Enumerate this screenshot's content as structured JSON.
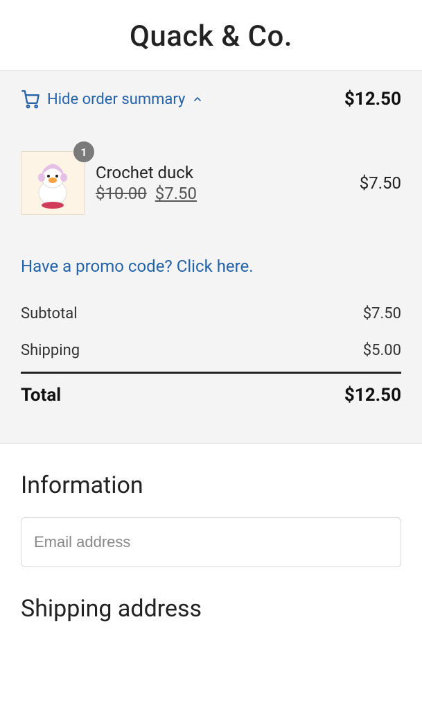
{
  "header": {
    "title": "Quack & Co."
  },
  "summary": {
    "toggle_label": "Hide order summary",
    "total_top": "$12.50",
    "item": {
      "qty": "1",
      "name": "Crochet duck",
      "original_price": "$10.00",
      "sale_price": "$7.50",
      "line_price": "$7.50"
    },
    "promo_link": "Have a promo code? Click here.",
    "subtotal_label": "Subtotal",
    "subtotal_value": "$7.50",
    "shipping_label": "Shipping",
    "shipping_value": "$5.00",
    "total_label": "Total",
    "total_value": "$12.50"
  },
  "information": {
    "heading": "Information",
    "email_placeholder": "Email address"
  },
  "shipping": {
    "heading": "Shipping address"
  }
}
